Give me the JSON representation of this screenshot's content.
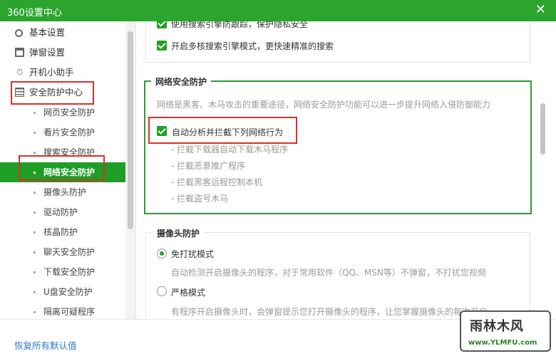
{
  "window": {
    "title": "360设置中心",
    "close_icon": "close-icon"
  },
  "sidebar": {
    "items": [
      {
        "label": "基本设置",
        "icon": "gear-icon",
        "type": "category"
      },
      {
        "label": "弹窗设置",
        "icon": "window-icon",
        "type": "category"
      },
      {
        "label": "开机小助手",
        "icon": "timer-icon",
        "type": "category"
      },
      {
        "label": "安全防护中心",
        "icon": "shield-grid-icon",
        "type": "category"
      },
      {
        "label": "网页安全防护",
        "type": "sub"
      },
      {
        "label": "看片安全防护",
        "type": "sub"
      },
      {
        "label": "搜索安全防护",
        "type": "sub"
      },
      {
        "label": "网络安全防护",
        "type": "sub",
        "active": true
      },
      {
        "label": "摄像头防护",
        "type": "sub"
      },
      {
        "label": "驱动防护",
        "type": "sub"
      },
      {
        "label": "核晶防护",
        "type": "sub"
      },
      {
        "label": "聊天安全防护",
        "type": "sub"
      },
      {
        "label": "下载安全防护",
        "type": "sub"
      },
      {
        "label": "U盘安全防护",
        "type": "sub"
      },
      {
        "label": "隔离可疑程序",
        "type": "sub"
      }
    ]
  },
  "footer": {
    "restore_label": "恢复所有默认值"
  },
  "main": {
    "search_section": {
      "opt1": "使用搜索引擎防跟踪，保护隐私安全",
      "opt2": "开启多核搜索引擎模式，更快速精准的搜索"
    },
    "network_section": {
      "legend": "网络安全防护",
      "desc": "网络是黑客、木马攻击的重要途径，网络安全防护功能可以进一步提升网络入侵防御能力",
      "main_option": "自动分析并拦截下列网络行为",
      "bullets": [
        "- 拦截下载器自动下载木马程序",
        "- 拦截恶意推广程序",
        "- 拦截黑客远程控制本机",
        "- 拦截盗号木马"
      ]
    },
    "camera_section": {
      "legend": "摄像头防护",
      "mode1": "免打扰模式",
      "mode1_desc": "自动检测开启摄像头的程序，对于常用软件（QQ、MSN等）不弹窗，不打扰您视频",
      "mode2": "严格模式",
      "mode2_desc": "有程序开启摄像头时，会弹窗提示您打开摄像头的程序，让您掌握摄像头的每次开启"
    }
  },
  "watermark": {
    "title": "雨林木风",
    "url": "www.YLMFU.com"
  },
  "colors": {
    "brand_green": "#2ba52d",
    "active_green": "#1f9d24",
    "highlight_red": "#d9302c",
    "link_blue": "#2a7ac8"
  }
}
